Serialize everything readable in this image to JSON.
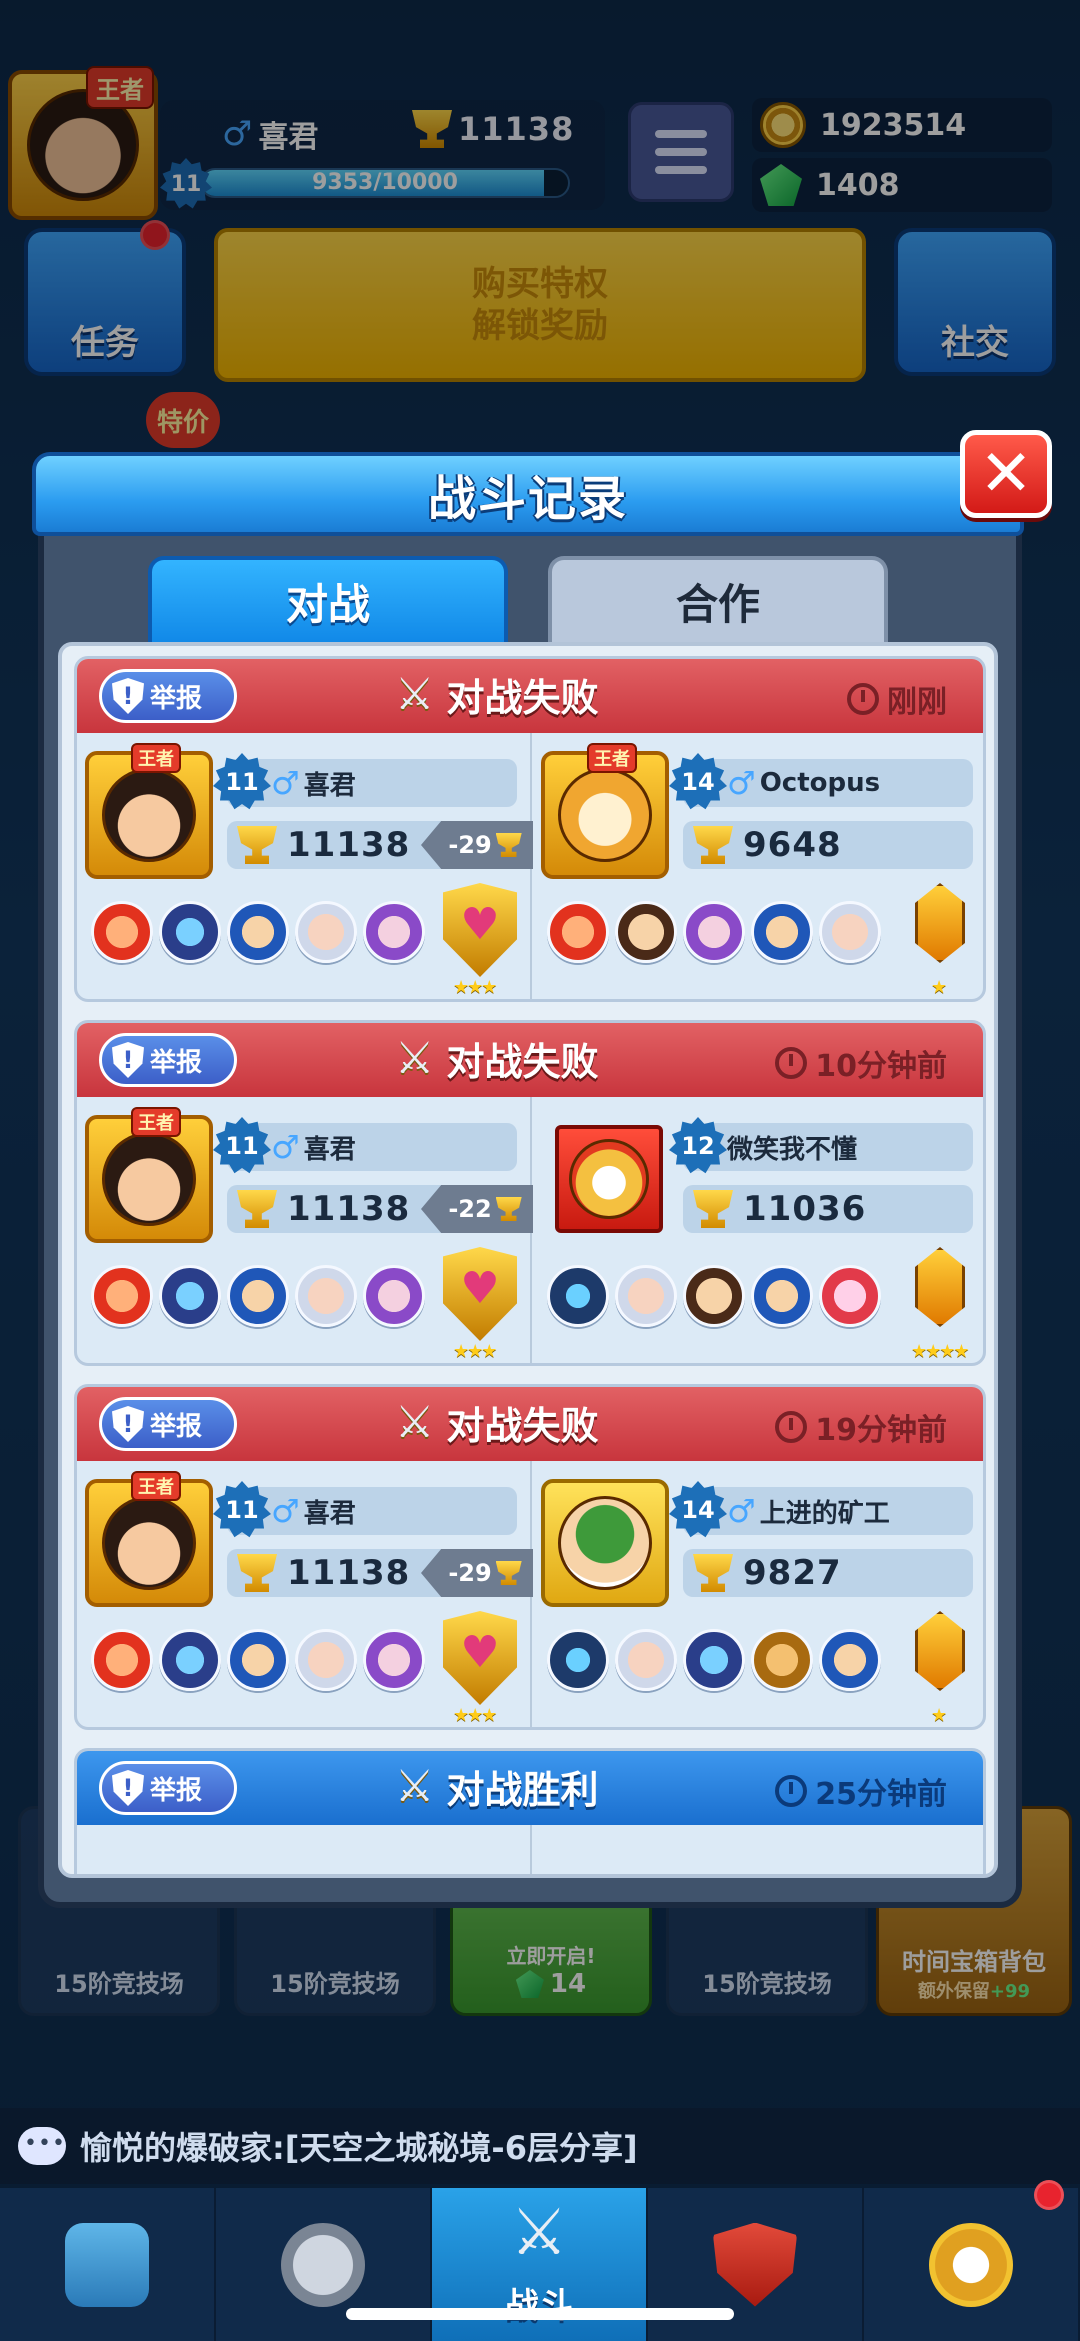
{
  "hud": {
    "king_tag": "王者",
    "player_name": "喜君",
    "trophies": "11138",
    "level": "11",
    "xp_text": "9353/10000",
    "xp_progress": 0.9353,
    "coins": "1923514",
    "gems": "1408"
  },
  "top_buttons": {
    "tasks": "任务",
    "vip_line1": "购买特权",
    "vip_line2": "解锁奖励",
    "social": "社交",
    "special_offer": "特价"
  },
  "modal": {
    "title": "战斗记录",
    "tabs": [
      "对战",
      "合作"
    ],
    "close": "✕"
  },
  "records": [
    {
      "report": "举报",
      "result": "对战失败",
      "outcome": "lose",
      "time": "刚刚",
      "left": {
        "level": "11",
        "name": "喜君",
        "trophies": "11138",
        "delta": "-29",
        "king_tag": "王者",
        "stars": "★★★"
      },
      "right": {
        "level": "14",
        "name": "Octopus",
        "trophies": "9648",
        "king_tag": "王者",
        "stars": "★"
      }
    },
    {
      "report": "举报",
      "result": "对战失败",
      "outcome": "lose",
      "time": "10分钟前",
      "left": {
        "level": "11",
        "name": "喜君",
        "trophies": "11138",
        "delta": "-22",
        "king_tag": "王者",
        "stars": "★★★"
      },
      "right": {
        "level": "12",
        "name": "微笑我不懂",
        "trophies": "11036",
        "stars": "★★★★"
      }
    },
    {
      "report": "举报",
      "result": "对战失败",
      "outcome": "lose",
      "time": "19分钟前",
      "left": {
        "level": "11",
        "name": "喜君",
        "trophies": "11138",
        "delta": "-29",
        "king_tag": "王者",
        "stars": "★★★"
      },
      "right": {
        "level": "14",
        "name": "上进的矿工",
        "trophies": "9827",
        "stars": "★"
      }
    },
    {
      "report": "举报",
      "result": "对战胜利",
      "outcome": "win",
      "time": "25分钟前"
    }
  ],
  "chests": [
    {
      "label": "15阶竞技场"
    },
    {
      "label": "15阶竞技场"
    },
    {
      "label": "立即开启!",
      "gems": "14"
    },
    {
      "label": "15阶竞技场"
    }
  ],
  "time_bag": {
    "title": "时间宝箱背包",
    "sub": "额外保留",
    "bonus": "+99"
  },
  "chat": {
    "text": "愉悦的爆破家:[天空之城秘境-6层分享]"
  },
  "nav": {
    "active_label": "战斗"
  },
  "colors": {
    "lose_header": "#c8353d",
    "win_header": "#1a6fcf",
    "accent": "#1189e8"
  }
}
